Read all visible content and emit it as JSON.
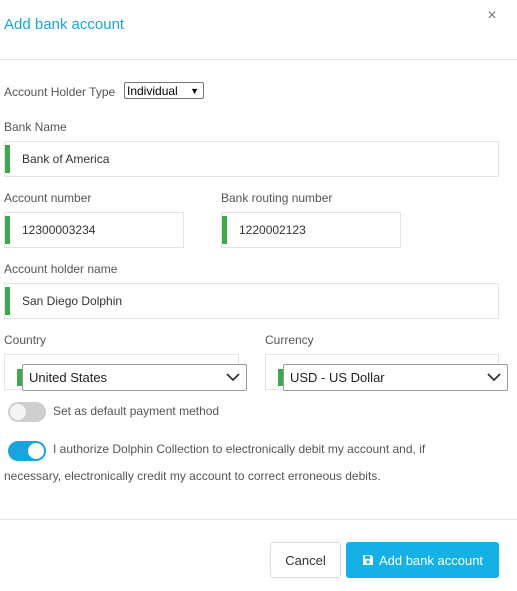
{
  "dialog": {
    "title": "Add bank account",
    "close_label": "×"
  },
  "form": {
    "holder_type": {
      "label": "Account Holder Type",
      "value": "Individual"
    },
    "bank_name": {
      "label": "Bank Name",
      "value": "Bank of America"
    },
    "account_number": {
      "label": "Account number",
      "value": "12300003234"
    },
    "routing_number": {
      "label": "Bank routing number",
      "value": "1220002123"
    },
    "holder_name": {
      "label": "Account holder name",
      "value": "San Diego Dolphin"
    },
    "country": {
      "label": "Country",
      "value": "United States"
    },
    "currency": {
      "label": "Currency",
      "value": "USD - US Dollar"
    },
    "default_payment": {
      "label": "Set as default payment method",
      "enabled": false
    },
    "authorize": {
      "label": "I authorize Dolphin Collection to electronically debit my account and, if",
      "label_line2": "necessary, electronically credit my account to correct erroneous debits.",
      "enabled": true
    }
  },
  "footer": {
    "cancel_label": "Cancel",
    "submit_label": "Add bank account"
  },
  "colors": {
    "accent": "#1aa3dd",
    "valid_bar": "#3fa84f",
    "button": "#15b1e6"
  }
}
